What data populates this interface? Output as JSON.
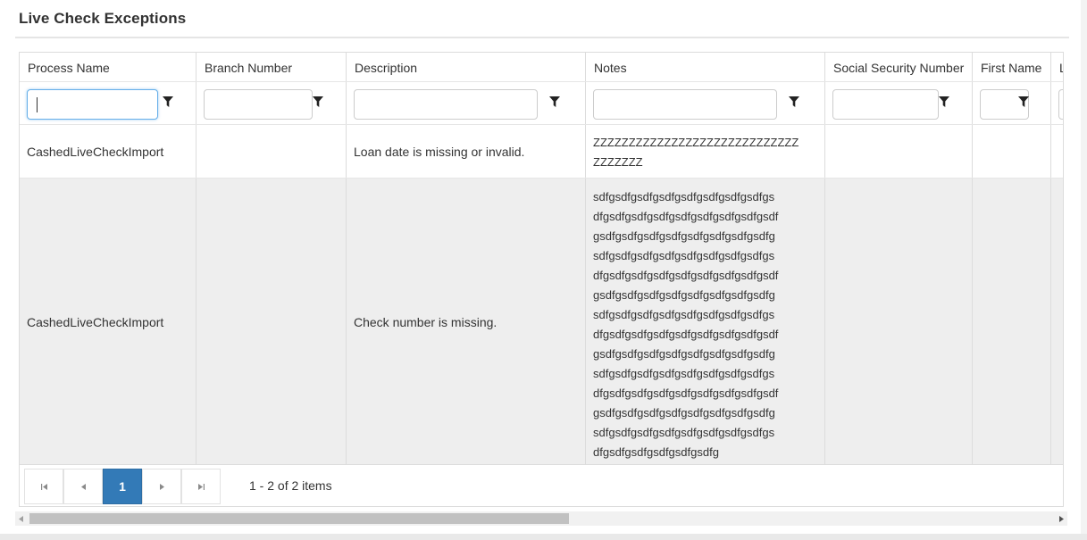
{
  "page": {
    "title": "Live Check Exceptions"
  },
  "grid": {
    "columns": [
      {
        "label": "Process Name"
      },
      {
        "label": "Branch Number"
      },
      {
        "label": "Description"
      },
      {
        "label": "Notes"
      },
      {
        "label": "Social Security Number"
      },
      {
        "label": "First Name"
      },
      {
        "label": "La"
      }
    ],
    "filters": {
      "process_name": "",
      "branch_number": "",
      "description": "",
      "notes": "",
      "ssn": "",
      "first_name": ""
    },
    "rows": [
      {
        "process_name": "CashedLiveCheckImport",
        "branch_number": "",
        "description": "Loan date is missing or invalid.",
        "notes_lines": [
          "ZZZZZZZZZZZZZZZZZZZZZZZZZZZZZ",
          "ZZZZZZZ"
        ]
      },
      {
        "process_name": "CashedLiveCheckImport",
        "branch_number": "",
        "description": "Check number is missing.",
        "notes_lines": [
          "sdfgsdfgsdfgsdfgsdfgsdfgsdfgsdfgs",
          "dfgsdfgsdfgsdfgsdfgsdfgsdfgsdfgsdf",
          "gsdfgsdfgsdfgsdfgsdfgsdfgsdfgsdfg",
          "sdfgsdfgsdfgsdfgsdfgsdfgsdfgsdfgs",
          "dfgsdfgsdfgsdfgsdfgsdfgsdfgsdfgsdf",
          "gsdfgsdfgsdfgsdfgsdfgsdfgsdfgsdfg",
          "sdfgsdfgsdfgsdfgsdfgsdfgsdfgsdfgs",
          "dfgsdfgsdfgsdfgsdfgsdfgsdfgsdfgsdf",
          "gsdfgsdfgsdfgsdfgsdfgsdfgsdfgsdfg",
          "sdfgsdfgsdfgsdfgsdfgsdfgsdfgsdfgs",
          "dfgsdfgsdfgsdfgsdfgsdfgsdfgsdfgsdf",
          "gsdfgsdfgsdfgsdfgsdfgsdfgsdfgsdfg",
          "sdfgsdfgsdfgsdfgsdfgsdfgsdfgsdfgs",
          "dfgsdfgsdfgsdfgsdfgsdfg"
        ]
      }
    ]
  },
  "pager": {
    "current_page": "1",
    "info": "1 - 2 of 2 items",
    "horizontal_scroll_position": 0.0
  },
  "icons": {
    "filter": "filter-icon",
    "first": "first-page-icon",
    "prev": "prev-page-icon",
    "next": "next-page-icon",
    "last": "last-page-icon"
  },
  "colors": {
    "accent": "#337ab7",
    "focus": "#66afe9",
    "alt_row": "#eeeeee",
    "border": "#dcdcdc"
  }
}
